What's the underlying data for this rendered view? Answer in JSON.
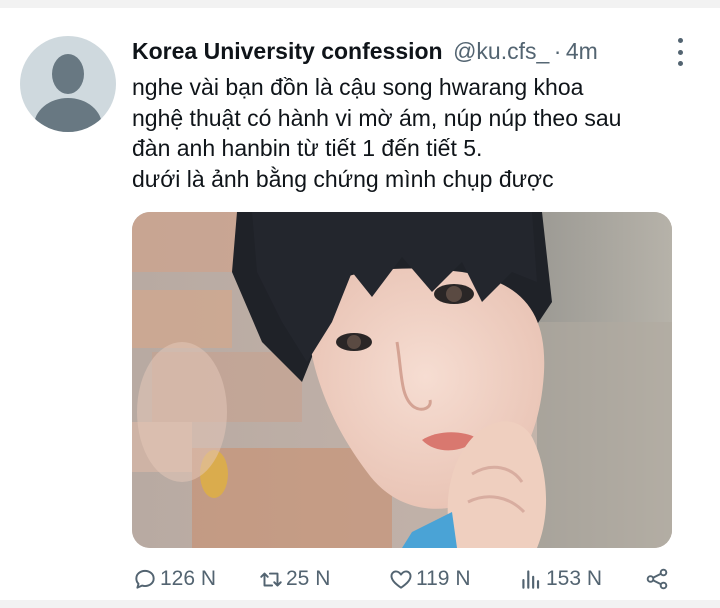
{
  "tweet": {
    "author_name": "Korea University confession",
    "handle": "@ku.cfs_",
    "separator": "·",
    "time": "4m",
    "text_lines": [
      "nghe vài bạn đồn là cậu song hwarang khoa",
      "nghệ thuật có hành vi mờ ám, núp núp theo sau",
      "đàn anh hanbin từ tiết 1 đến tiết 5.",
      "dưới là ảnh bằng chứng mình chụp được"
    ]
  },
  "actions": {
    "replies": "126 N",
    "retweets": "25 N",
    "likes": "119 N",
    "views": "153 N"
  },
  "icons": {
    "reply": "reply-icon",
    "retweet": "retweet-icon",
    "like": "heart-icon",
    "views": "views-icon",
    "share": "share-icon",
    "more": "more-vertical-icon"
  },
  "colors": {
    "text": "#0f1419",
    "secondary": "#536471",
    "avatar_bg": "#cfd9de"
  }
}
